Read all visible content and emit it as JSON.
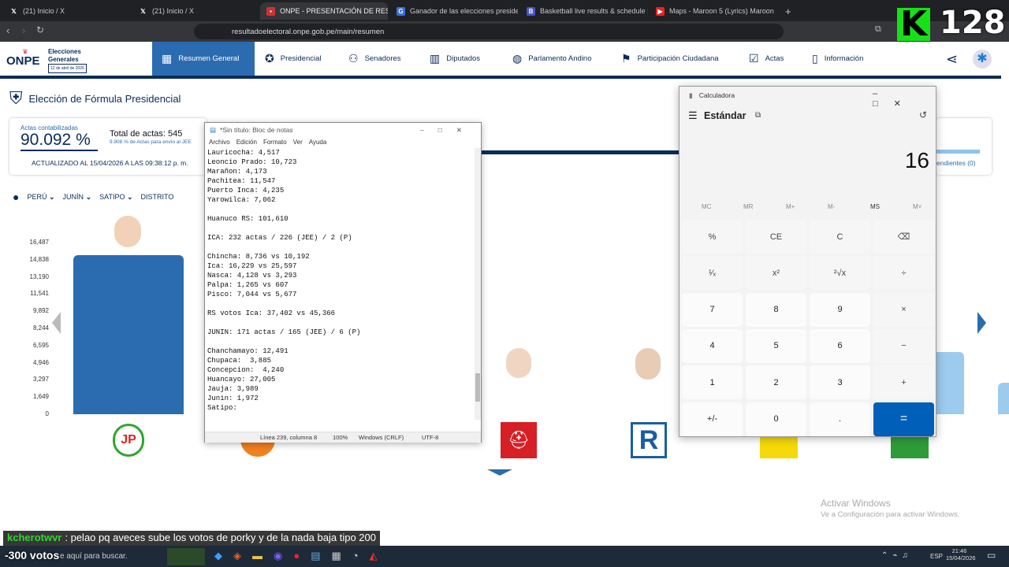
{
  "browser": {
    "tabs": [
      {
        "label": "(21) Inicio / X",
        "icon": "x-icon"
      },
      {
        "label": "(21) Inicio / X",
        "icon": "x-icon"
      },
      {
        "label": "ONPE - PRESENTACIÓN DE RESU",
        "icon": "onpe-icon"
      },
      {
        "label": "Ganador de las elecciones presidencia",
        "icon": "search-icon"
      },
      {
        "label": "Basketball live results & schedule | Sc",
        "icon": "sports-icon"
      },
      {
        "label": "Maps - Maroon 5 (Lyrics) Maroon",
        "icon": "youtube-icon"
      }
    ],
    "url": "resultadoelectoral.onpe.gob.pe/main/resumen"
  },
  "stream": {
    "logo_letter": "K",
    "viewers": "128",
    "chat_user": "kcherotwvr",
    "chat_message": ": pelao pq aveces sube los votos de porky y de la nada baja tipo 200",
    "votes_overlay": "-300 votos"
  },
  "onpe": {
    "logo": "ONPE",
    "brand_line1": "Elecciones",
    "brand_line2": "Generales",
    "brand_date": "12 de abril de 2026",
    "nav": [
      "Resumen General",
      "Presidencial",
      "Senadores",
      "Diputados",
      "Parlamento Andino",
      "Participación Ciudadana",
      "Actas",
      "Información"
    ],
    "page_title": "Elección de Fórmula Presidencial",
    "actas_label": "Actas contabilizadas",
    "actas_pct": "90.092 %",
    "total_actas": "Total de actas: 545",
    "jee_note": "9.908 % de Actas para envío al JEE",
    "updated": "ACTUALIZADO AL 15/04/2026 A LAS 09:38:12 p. m.",
    "pendientes": "endientes (0)",
    "filters": [
      "PERÚ",
      "JUNÍN",
      "SATIPO",
      "DISTRITO"
    ]
  },
  "chart_data": {
    "type": "bar",
    "yticks": [
      "16,487",
      "14,838",
      "13,190",
      "11,541",
      "9,892",
      "8,244",
      "6,595",
      "4,946",
      "3,297",
      "1,649",
      "0"
    ],
    "ylim": [
      0,
      16487
    ],
    "visible_bars": [
      {
        "x": 1,
        "value": 15300
      },
      {
        "x": 6,
        "value": 6000
      },
      {
        "x": 7,
        "value": 6000
      },
      {
        "x": 8,
        "value": 3000
      }
    ]
  },
  "notepad": {
    "title": "*Sin título: Bloc de notas",
    "menu": [
      "Archivo",
      "Edición",
      "Formato",
      "Ver",
      "Ayuda"
    ],
    "lines": [
      "Lauricocha: 4,517",
      "Leoncio Prado: 10,723",
      "Marañon: 4,173",
      "Pachitea: 11,547",
      "Puerto Inca: 4,235",
      "Yarowilca: 7,062",
      "",
      "Huanuco RS: 101,610",
      "",
      "ICA: 232 actas / 226 (JEE) / 2 (P)",
      "",
      "Chincha: 8,736 vs 10,192",
      "Ica: 16,229 vs 25,597",
      "Nasca: 4,128 vs 3,293",
      "Palpa: 1,265 vs 607",
      "Pisco: 7,044 vs 5,677",
      "",
      "RS votos Ica: 37,402 vs 45,366",
      "",
      "JUNIN: 171 actas / 165 (JEE) / 6 (P)",
      "",
      "Chanchamayo: 12,491",
      "Chupaca:  3,885",
      "Concepcion:  4,240",
      "Huancayo: 27,005",
      "Jauja: 3,989",
      "Junin: 1,972",
      "Satipo:"
    ],
    "status": [
      "Línea 239, columna 8",
      "100%",
      "Windows (CRLF)",
      "UTF-8"
    ]
  },
  "calculator": {
    "title": "Calculadora",
    "mode": "Estándar",
    "display": "16",
    "memory": [
      "MC",
      "MR",
      "M+",
      "M-",
      "MS",
      "M˅"
    ],
    "keys": [
      "%",
      "CE",
      "C",
      "⌫",
      "¹⁄ₓ",
      "x²",
      "²√x",
      "÷",
      "7",
      "8",
      "9",
      "×",
      "4",
      "5",
      "6",
      "−",
      "1",
      "2",
      "3",
      "+",
      "+/-",
      "0",
      ".",
      "="
    ]
  },
  "windows": {
    "activate_title": "Activar Windows",
    "activate_sub": "Ve a Configuración para activar Windows.",
    "search": "e aquí para buscar.",
    "lang": "ESP",
    "time": "21:46",
    "date": "15/04/2026"
  }
}
